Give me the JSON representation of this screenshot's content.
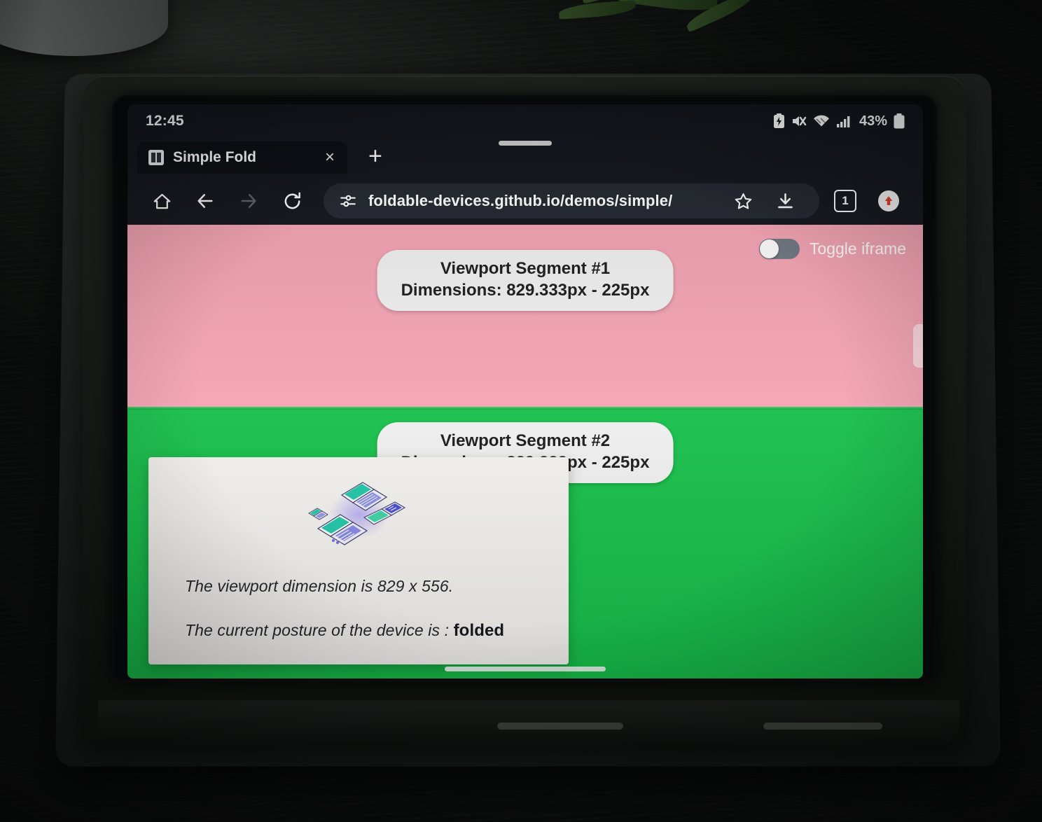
{
  "status_bar": {
    "clock": "12:45",
    "battery_percent": "43%",
    "icons": [
      "battery-saver-icon",
      "mute-icon",
      "wifi-icon",
      "cellular-signal-icon",
      "battery-icon"
    ]
  },
  "browser": {
    "tab": {
      "title": "Simple Fold",
      "favicon": "simple-fold-favicon",
      "close_label": "×"
    },
    "new_tab_label": "+",
    "toolbar": {
      "home_icon": "home-icon",
      "back_icon": "back-arrow-icon",
      "forward_icon": "forward-arrow-icon",
      "reload_icon": "reload-icon",
      "site_settings_icon": "tune-icon",
      "url": "foldable-devices.github.io/demos/simple/",
      "bookmark_icon": "star-icon",
      "download_icon": "download-icon",
      "tab_count": "1",
      "profile_icon": "profile-avatar-icon"
    }
  },
  "page": {
    "segment1": {
      "name": "Viewport Segment #1",
      "dimensions": "Dimensions: 829.333px - 225px",
      "color": "#f4a3b3"
    },
    "segment2": {
      "name": "Viewport Segment #2",
      "dimensions": "Dimensions: 829.333px - 225px",
      "color": "#18c04b"
    },
    "toggle": {
      "label": "Toggle iframe",
      "state": "off"
    },
    "card": {
      "illustration": "foldable-devices-illustration",
      "viewport_line": "The viewport dimension is 829 x 556.",
      "posture_lead": "The current posture of the device is : ",
      "posture_value": "folded"
    }
  },
  "device": {
    "gesture_bar": "gesture-navigation-bar",
    "drag_handle": "tab-strip-drag-handle"
  }
}
